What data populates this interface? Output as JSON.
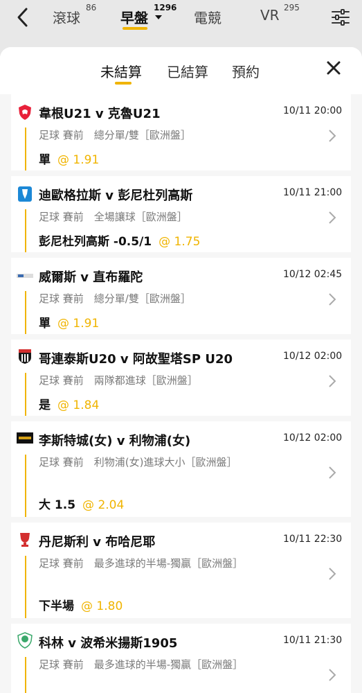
{
  "nav": {
    "tabs": [
      {
        "label": "滾球",
        "count": "86"
      },
      {
        "label": "早盤",
        "count": "1296"
      },
      {
        "label": "電競",
        "count": ""
      },
      {
        "label": "VR",
        "count": "295"
      }
    ]
  },
  "sheet": {
    "tabs": [
      "未結算",
      "已結算",
      "預約"
    ]
  },
  "bets": [
    {
      "match": "韋根U21 v 克魯U21",
      "time": "10/11 20:00",
      "meta": "足球 賽前　總分單/雙［歐洲盤］",
      "selection": "單",
      "odds": "@ 1.91"
    },
    {
      "match": "迪歐格拉斯 v 彭尼杜列高斯",
      "time": "10/11 21:00",
      "meta": "足球 賽前　全場讓球［歐洲盤］",
      "selection": "彭尼杜列高斯 -0.5/1",
      "odds": "@ 1.75"
    },
    {
      "match": "威爾斯 v 直布羅陀",
      "time": "10/12 02:45",
      "meta": "足球 賽前　總分單/雙［歐洲盤］",
      "selection": "單",
      "odds": "@ 1.91"
    },
    {
      "match": "哥連泰斯U20 v 阿故聖塔SP U20",
      "time": "10/12 02:00",
      "meta": "足球 賽前　兩隊都進球［歐洲盤］",
      "selection": "是",
      "odds": "@ 1.84"
    },
    {
      "match": "李斯特城(女) v 利物浦(女)",
      "time": "10/12 02:00",
      "meta": "足球 賽前　利物浦(女)進球大小［歐洲盤］",
      "selection": "大 1.5",
      "odds": "@ 2.04"
    },
    {
      "match": "丹尼斯利 v 布哈尼耶",
      "time": "10/11 22:30",
      "meta": "足球 賽前　最多進球的半場-獨贏［歐洲盤］",
      "selection": "下半場",
      "odds": "@ 1.80"
    },
    {
      "match": "科林 v 波希米揚斯1905",
      "time": "10/11 21:30",
      "meta": "足球 賽前　最多進球的半場-獨贏［歐洲盤］",
      "selection": "",
      "odds": ""
    }
  ]
}
